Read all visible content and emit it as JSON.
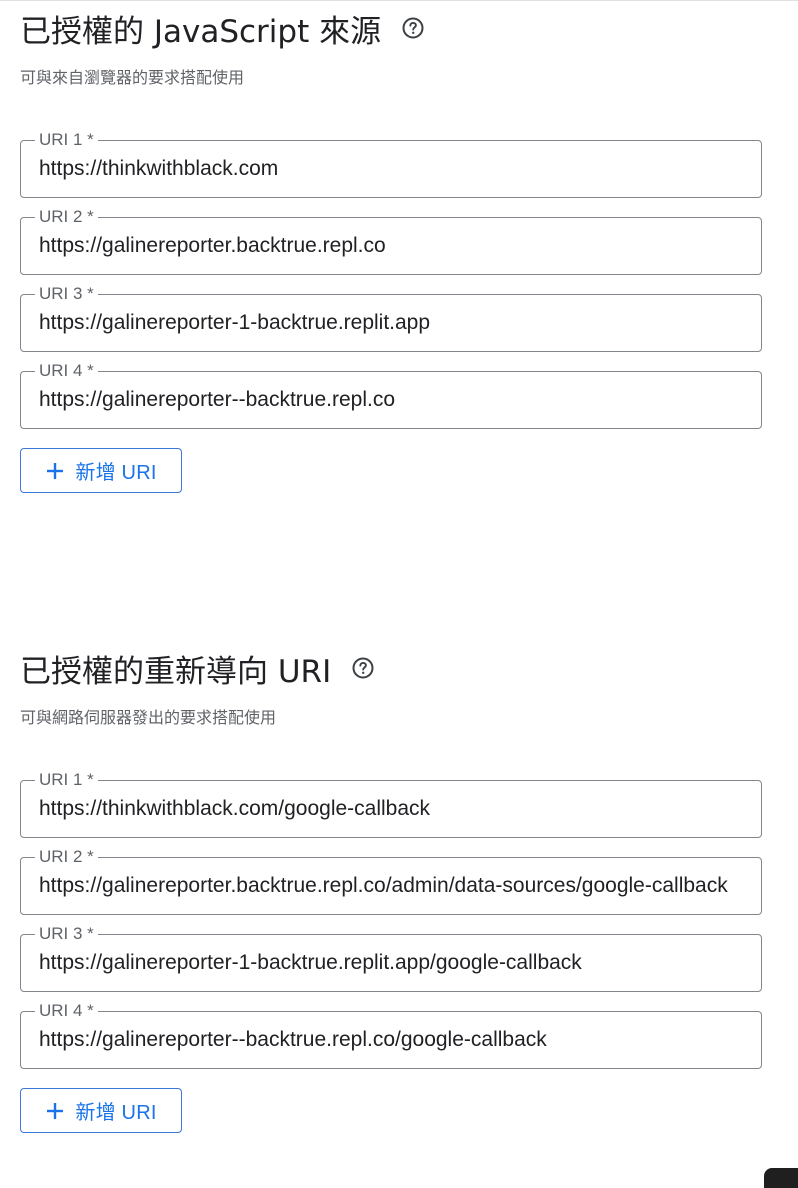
{
  "js_origins": {
    "title": "已授權的 JavaScript 來源",
    "help_icon": "help-circle-icon",
    "subtitle": "可與來自瀏覽器的要求搭配使用",
    "fields": [
      {
        "label": "URI 1 *",
        "value": "https://thinkwithblack.com"
      },
      {
        "label": "URI 2 *",
        "value": "https://galinereporter.backtrue.repl.co"
      },
      {
        "label": "URI 3 *",
        "value": "https://galinereporter-1-backtrue.replit.app"
      },
      {
        "label": "URI 4 *",
        "value": "https://galinereporter--backtrue.repl.co"
      }
    ],
    "add_button": {
      "icon": "plus-icon",
      "label": "新增 URI"
    }
  },
  "redirect_uris": {
    "title": "已授權的重新導向 URI",
    "help_icon": "help-circle-icon",
    "subtitle": "可與網路伺服器發出的要求搭配使用",
    "fields": [
      {
        "label": "URI 1 *",
        "value": "https://thinkwithblack.com/google-callback"
      },
      {
        "label": "URI 2 *",
        "value": "https://galinereporter.backtrue.repl.co/admin/data-sources/google-callback"
      },
      {
        "label": "URI 3 *",
        "value": "https://galinereporter-1-backtrue.replit.app/google-callback"
      },
      {
        "label": "URI 4 *",
        "value": "https://galinereporter--backtrue.repl.co/google-callback"
      }
    ],
    "add_button": {
      "icon": "plus-icon",
      "label": "新增 URI"
    }
  },
  "colors": {
    "accent": "#1a73e8",
    "button_border": "#3c78d8",
    "field_border": "#80868b",
    "label_text": "#5f6368",
    "body_text": "#202124"
  }
}
